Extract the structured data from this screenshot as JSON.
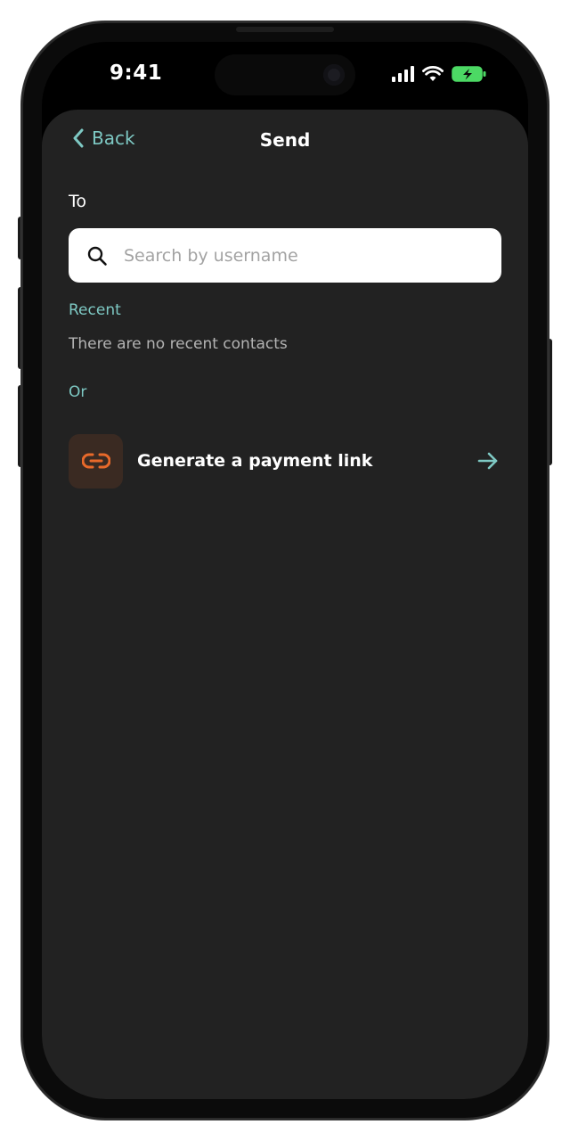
{
  "status_bar": {
    "time": "9:41"
  },
  "nav": {
    "back_label": "Back",
    "title": "Send"
  },
  "form": {
    "to_label": "To",
    "search_placeholder": "Search by username",
    "search_value": ""
  },
  "recent": {
    "label": "Recent",
    "empty_text": "There are no recent contacts"
  },
  "alternative": {
    "label": "Or",
    "payment_link_label": "Generate a payment link"
  },
  "colors": {
    "accent": "#7ec9c4",
    "link_icon": "#e8692a",
    "battery": "#4cd964"
  },
  "icons": {
    "back": "chevron-left-icon",
    "search": "search-icon",
    "link": "link-icon",
    "arrow": "arrow-right-icon",
    "signal": "signal-icon",
    "wifi": "wifi-icon",
    "battery": "battery-charging-icon"
  }
}
